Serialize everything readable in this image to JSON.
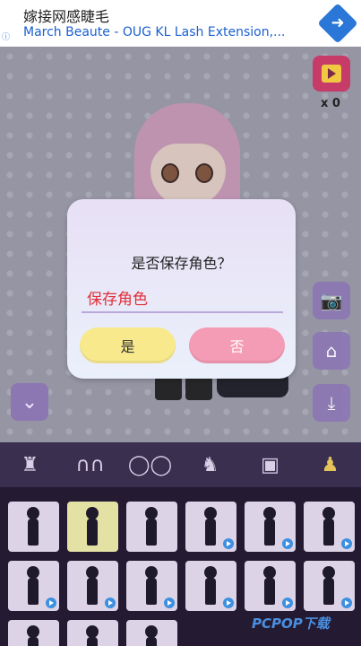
{
  "ad": {
    "title": "嫁接网感睫毛",
    "subtitle": "March Beaute - OUG KL Lash Extension,..."
  },
  "dialog": {
    "question": "是否保存角色？",
    "name_value": "保存角色",
    "yes_label": "是",
    "no_label": "否"
  },
  "video_reward": {
    "count": "x 0"
  },
  "categories": [
    {
      "icon": "bag-icon",
      "glyph": "👜"
    },
    {
      "icon": "bunny-ears-icon",
      "glyph": "🐰"
    },
    {
      "icon": "glasses-icon",
      "glyph": "👓"
    },
    {
      "icon": "cat-icon",
      "glyph": "🐱"
    },
    {
      "icon": "picture-icon",
      "glyph": "🖼"
    },
    {
      "icon": "person-icon",
      "glyph": "🧍"
    }
  ],
  "watermark": "PCPOP下载",
  "colors": {
    "dialog_name": "#e0303a",
    "yes_button": "#f7e98c",
    "no_button": "#f49bb5",
    "category_bar": "#3b2f4f",
    "active_category": "#e3c35a"
  }
}
